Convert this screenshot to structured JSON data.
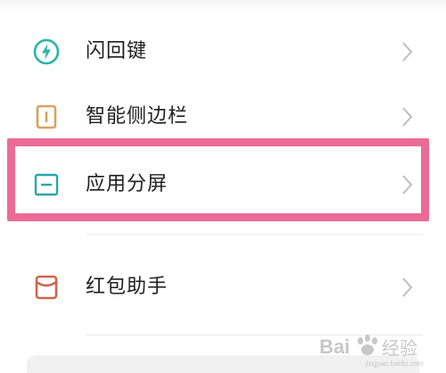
{
  "menu": {
    "items": [
      {
        "label": "闪回键",
        "icon": "lightning-circle-icon",
        "color": "#2bb5a6"
      },
      {
        "label": "智能侧边栏",
        "icon": "sidebar-icon",
        "color": "#d7a35a"
      },
      {
        "label": "应用分屏",
        "icon": "split-screen-icon",
        "color": "#2aa6a8"
      },
      {
        "label": "红包助手",
        "icon": "red-envelope-icon",
        "color": "#d0634e"
      }
    ]
  },
  "highlight": {
    "color": "#ec6b96",
    "target": "应用分屏"
  },
  "watermark": {
    "text": "Bai经验",
    "subtext": "jingyan.baidu.com"
  }
}
